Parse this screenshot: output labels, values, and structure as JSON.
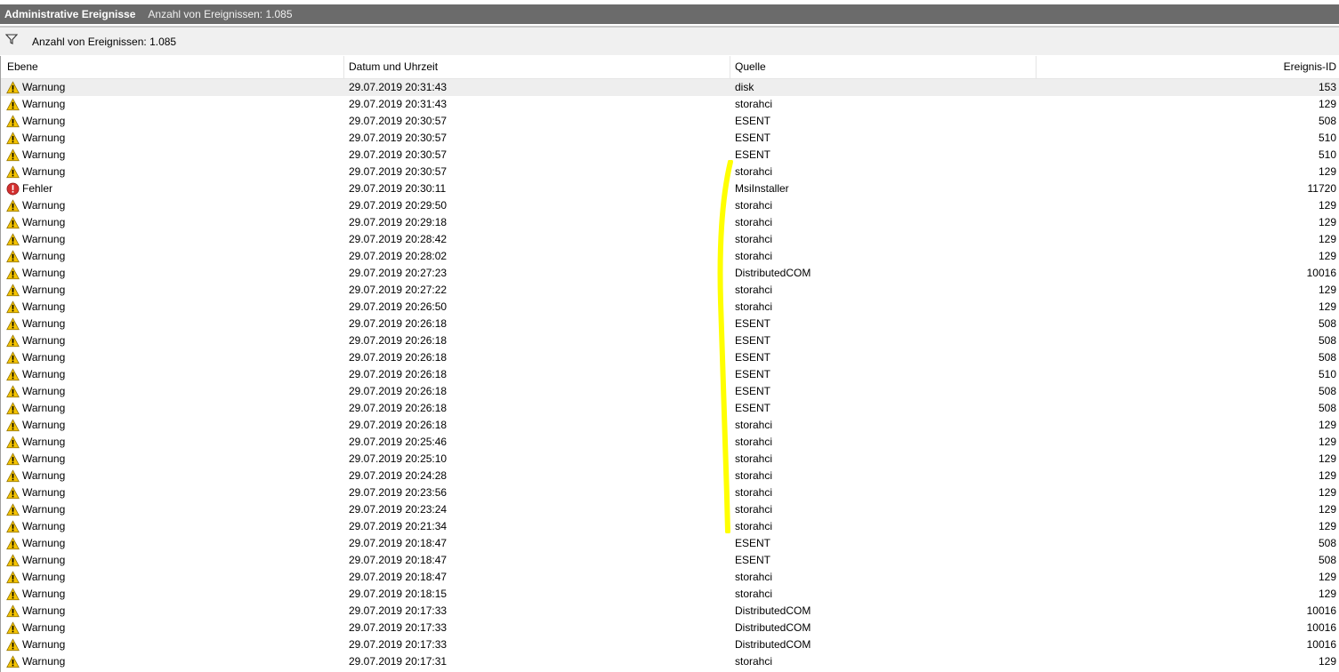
{
  "titlebar": {
    "title": "Administrative Ereignisse",
    "count": "Anzahl von Ereignissen: 1.085"
  },
  "filterbar": {
    "text": "Anzahl von Ereignissen: 1.085"
  },
  "columns": {
    "level": "Ebene",
    "date": "Datum und Uhrzeit",
    "source": "Quelle",
    "id": "Ereignis-ID"
  },
  "colors": {
    "warning": "#f5c400",
    "error": "#d32f2f",
    "annotation": "#ffff00",
    "titlebar": "#6b6b6b"
  },
  "rows": [
    {
      "level": "Warnung",
      "icon": "warning-icon",
      "date": "29.07.2019 20:31:43",
      "source": "disk",
      "id": "153"
    },
    {
      "level": "Warnung",
      "icon": "warning-icon",
      "date": "29.07.2019 20:31:43",
      "source": "storahci",
      "id": "129"
    },
    {
      "level": "Warnung",
      "icon": "warning-icon",
      "date": "29.07.2019 20:30:57",
      "source": "ESENT",
      "id": "508"
    },
    {
      "level": "Warnung",
      "icon": "warning-icon",
      "date": "29.07.2019 20:30:57",
      "source": "ESENT",
      "id": "510"
    },
    {
      "level": "Warnung",
      "icon": "warning-icon",
      "date": "29.07.2019 20:30:57",
      "source": "ESENT",
      "id": "510"
    },
    {
      "level": "Warnung",
      "icon": "warning-icon",
      "date": "29.07.2019 20:30:57",
      "source": "storahci",
      "id": "129"
    },
    {
      "level": "Fehler",
      "icon": "error-icon",
      "date": "29.07.2019 20:30:11",
      "source": "MsiInstaller",
      "id": "11720"
    },
    {
      "level": "Warnung",
      "icon": "warning-icon",
      "date": "29.07.2019 20:29:50",
      "source": "storahci",
      "id": "129"
    },
    {
      "level": "Warnung",
      "icon": "warning-icon",
      "date": "29.07.2019 20:29:18",
      "source": "storahci",
      "id": "129"
    },
    {
      "level": "Warnung",
      "icon": "warning-icon",
      "date": "29.07.2019 20:28:42",
      "source": "storahci",
      "id": "129"
    },
    {
      "level": "Warnung",
      "icon": "warning-icon",
      "date": "29.07.2019 20:28:02",
      "source": "storahci",
      "id": "129"
    },
    {
      "level": "Warnung",
      "icon": "warning-icon",
      "date": "29.07.2019 20:27:23",
      "source": "DistributedCOM",
      "id": "10016"
    },
    {
      "level": "Warnung",
      "icon": "warning-icon",
      "date": "29.07.2019 20:27:22",
      "source": "storahci",
      "id": "129"
    },
    {
      "level": "Warnung",
      "icon": "warning-icon",
      "date": "29.07.2019 20:26:50",
      "source": "storahci",
      "id": "129"
    },
    {
      "level": "Warnung",
      "icon": "warning-icon",
      "date": "29.07.2019 20:26:18",
      "source": "ESENT",
      "id": "508"
    },
    {
      "level": "Warnung",
      "icon": "warning-icon",
      "date": "29.07.2019 20:26:18",
      "source": "ESENT",
      "id": "508"
    },
    {
      "level": "Warnung",
      "icon": "warning-icon",
      "date": "29.07.2019 20:26:18",
      "source": "ESENT",
      "id": "508"
    },
    {
      "level": "Warnung",
      "icon": "warning-icon",
      "date": "29.07.2019 20:26:18",
      "source": "ESENT",
      "id": "510"
    },
    {
      "level": "Warnung",
      "icon": "warning-icon",
      "date": "29.07.2019 20:26:18",
      "source": "ESENT",
      "id": "508"
    },
    {
      "level": "Warnung",
      "icon": "warning-icon",
      "date": "29.07.2019 20:26:18",
      "source": "ESENT",
      "id": "508"
    },
    {
      "level": "Warnung",
      "icon": "warning-icon",
      "date": "29.07.2019 20:26:18",
      "source": "storahci",
      "id": "129"
    },
    {
      "level": "Warnung",
      "icon": "warning-icon",
      "date": "29.07.2019 20:25:46",
      "source": "storahci",
      "id": "129"
    },
    {
      "level": "Warnung",
      "icon": "warning-icon",
      "date": "29.07.2019 20:25:10",
      "source": "storahci",
      "id": "129"
    },
    {
      "level": "Warnung",
      "icon": "warning-icon",
      "date": "29.07.2019 20:24:28",
      "source": "storahci",
      "id": "129"
    },
    {
      "level": "Warnung",
      "icon": "warning-icon",
      "date": "29.07.2019 20:23:56",
      "source": "storahci",
      "id": "129"
    },
    {
      "level": "Warnung",
      "icon": "warning-icon",
      "date": "29.07.2019 20:23:24",
      "source": "storahci",
      "id": "129"
    },
    {
      "level": "Warnung",
      "icon": "warning-icon",
      "date": "29.07.2019 20:21:34",
      "source": "storahci",
      "id": "129"
    },
    {
      "level": "Warnung",
      "icon": "warning-icon",
      "date": "29.07.2019 20:18:47",
      "source": "ESENT",
      "id": "508"
    },
    {
      "level": "Warnung",
      "icon": "warning-icon",
      "date": "29.07.2019 20:18:47",
      "source": "ESENT",
      "id": "508"
    },
    {
      "level": "Warnung",
      "icon": "warning-icon",
      "date": "29.07.2019 20:18:47",
      "source": "storahci",
      "id": "129"
    },
    {
      "level": "Warnung",
      "icon": "warning-icon",
      "date": "29.07.2019 20:18:15",
      "source": "storahci",
      "id": "129"
    },
    {
      "level": "Warnung",
      "icon": "warning-icon",
      "date": "29.07.2019 20:17:33",
      "source": "DistributedCOM",
      "id": "10016"
    },
    {
      "level": "Warnung",
      "icon": "warning-icon",
      "date": "29.07.2019 20:17:33",
      "source": "DistributedCOM",
      "id": "10016"
    },
    {
      "level": "Warnung",
      "icon": "warning-icon",
      "date": "29.07.2019 20:17:33",
      "source": "DistributedCOM",
      "id": "10016"
    },
    {
      "level": "Warnung",
      "icon": "warning-icon",
      "date": "29.07.2019 20:17:31",
      "source": "storahci",
      "id": "129"
    }
  ]
}
